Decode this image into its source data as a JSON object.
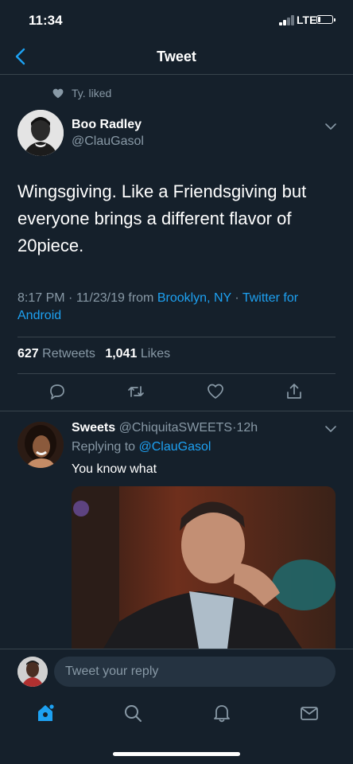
{
  "status_bar": {
    "time": "11:34",
    "network": "LTE",
    "signal_bars": 2,
    "battery_level": 0.15
  },
  "header": {
    "title": "Tweet",
    "back_icon": "chevron-left-icon"
  },
  "social_context": {
    "icon": "heart-icon",
    "text": "Ty. liked"
  },
  "tweet": {
    "name": "Boo Radley",
    "handle": "@ClauGasol",
    "text": "Wingsgiving. Like a Friendsgiving but everyone brings a different flavor of 20piece.",
    "time": "8:17 PM",
    "date": "11/23/19",
    "from_label": "from",
    "location": "Brooklyn, NY",
    "separator": "·",
    "source": "Twitter for Android",
    "retweets_count": "627",
    "retweets_label": "Retweets",
    "likes_count": "1,041",
    "likes_label": "Likes"
  },
  "actions": [
    "reply-icon",
    "retweet-icon",
    "like-icon",
    "share-icon"
  ],
  "reply": {
    "name": "Sweets",
    "handle": "@ChiquitaSWEETS",
    "time": "12h",
    "replying_label": "Replying to",
    "replying_to": "@ClauGasol",
    "text": "You know what"
  },
  "compose": {
    "placeholder": "Tweet your reply"
  },
  "tabs": [
    "home-icon",
    "search-icon",
    "notifications-icon",
    "messages-icon"
  ],
  "colors": {
    "background": "#15202b",
    "accent": "#1da1f2",
    "muted": "#8899a6",
    "divider": "#38444d"
  }
}
